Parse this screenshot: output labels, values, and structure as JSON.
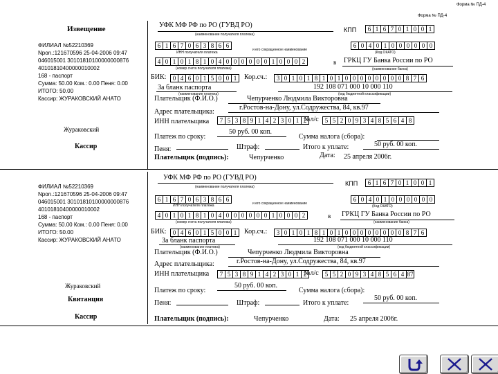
{
  "form_label": "Форма № ПД-4",
  "form_label_inner": "Форма № ПД-4",
  "notice": {
    "title": "Извещение",
    "cashier": "Кассир",
    "signature": "Жураковский",
    "receipt_lines": [
      "ФИЛИАЛ №52210369",
      "Npon.:121670596 25-04-2006 09:47",
      "046015001 30101810100000000876",
      "40101810400000010002",
      "168 - паспорт",
      "Сумма: 50.00 Ком.: 0.00 Пеня: 0.00",
      "ИТОГО:             50.00",
      "Кассир: ЖУРАКОВСКИЙ АНАТО"
    ],
    "payee": "УФК МФ РФ по РО (ГУВД РО)",
    "payee_caption": "(наименование получателя платежа)",
    "kpp_label": "КПП",
    "kpp_digits": [
      "6",
      "1",
      "6",
      "7",
      "0",
      "1",
      "0",
      "0",
      "1"
    ],
    "inn_digits": [
      "6",
      "1",
      "6",
      "7",
      "0",
      "6",
      "3",
      "8",
      "6",
      "6"
    ],
    "inn_caption": "ИНН получателя платежа",
    "code_caption": "и его сокращенное наименование",
    "okato_digits": [
      "6",
      "0",
      "4",
      "0",
      "1",
      "0",
      "0",
      "0",
      "0",
      "0",
      "0"
    ],
    "okato_caption": "(Код ОКАТО)",
    "account_digits": [
      "4",
      "0",
      "1",
      "0",
      "1",
      "8",
      "1",
      "0",
      "4",
      "0",
      "0",
      "0",
      "0",
      "0",
      "0",
      "1",
      "0",
      "0",
      "0",
      "2"
    ],
    "account_caption": "(номер счета получателя платежа)",
    "in_label": "в",
    "bank_name": "ГРКЦ ГУ Банка России по РО",
    "bank_caption": "(наименование банка)",
    "bik_label": "БИК:",
    "bik_digits": [
      "0",
      "4",
      "6",
      "0",
      "1",
      "5",
      "0",
      "0",
      "1"
    ],
    "kor_label": "Кор.сч.:",
    "kor_digits": [
      "3",
      "0",
      "1",
      "0",
      "1",
      "8",
      "1",
      "0",
      "1",
      "0",
      "0",
      "0",
      "0",
      "0",
      "0",
      "0",
      "0",
      "8",
      "7",
      "6"
    ],
    "purpose": "За бланк паспорта",
    "purpose_caption": "(наименование платежа)",
    "kbk": "192 108 071 000 10 000 110",
    "kbk_caption": "(код бюджетной классификации)",
    "payer_label": "Плательщик (Ф.И.О.)",
    "payer_name": "Чепурченко Людмила Викторовна",
    "address_label": "Адрес плательщика:",
    "address": "г.Ростов-на-Дону, ул.Содружества, 84, кв.97",
    "payer_inn_label": "ИНН плательщика",
    "payer_inn_digits": [
      "7",
      "5",
      "3",
      "8",
      "9",
      "1",
      "4",
      "2",
      "3",
      "0",
      "1",
      "2"
    ],
    "ls_label": "№л/с",
    "ls_digits": [
      "5",
      "5",
      "2",
      "0",
      "9",
      "3",
      "4",
      "8",
      "5",
      "6",
      "4",
      "8"
    ],
    "sum_label": "Платеж по сроку:",
    "sum_value": "50 руб. 00 коп.",
    "tax_label": "Сумма налога (сбора):",
    "fine_label": "Пеня:",
    "penalty_label": "Штраф:",
    "total_label": "Итого к уплате:",
    "total_value": "50 руб. 00 коп.",
    "date_label": "Дата:",
    "date_value": "25 апреля 2006г.",
    "sign_label": "Плательщик (подпись):",
    "sign_value": "Чепурченко"
  },
  "receipt": {
    "title": "Квитанция",
    "cashier": "Кассир",
    "signature": "Жураковский",
    "receipt_lines": [
      "ФИЛИАЛ №52210369",
      "Npon.:121670596 25-04-2006 09:47",
      "046015001 30101810100000000876",
      "40101810400000010002",
      "168 - паспорт",
      "Сумма: 50.00 Ком.: 0.00 Пеня: 0.00",
      "ИТОГО:             50.00",
      "Кассир: ЖУРАКОВСКИЙ АНАТО"
    ],
    "payee": "УФК МФ РФ по РО (ГУВД РО)",
    "payee_caption": "(наименование получателя платежа)",
    "kpp_label": "КПП",
    "kpp_digits": [
      "6",
      "1",
      "6",
      "7",
      "0",
      "1",
      "0",
      "0",
      "1"
    ],
    "inn_digits": [
      "6",
      "1",
      "6",
      "7",
      "0",
      "6",
      "3",
      "8",
      "6",
      "6"
    ],
    "inn_caption": "ИНН получателя платежа",
    "code_caption": "и его сокращенное наименование",
    "okato_digits": [
      "6",
      "0",
      "4",
      "0",
      "1",
      "0",
      "0",
      "0",
      "0",
      "0",
      "0"
    ],
    "okato_caption": "(Код ОКАТО)",
    "account_digits": [
      "4",
      "0",
      "1",
      "0",
      "1",
      "8",
      "1",
      "0",
      "4",
      "0",
      "0",
      "0",
      "0",
      "0",
      "0",
      "1",
      "0",
      "0",
      "0",
      "2"
    ],
    "account_caption": "(номер счета получателя платежа)",
    "in_label": "в",
    "bank_name": "ГРКЦ ГУ Банка России по РО",
    "bank_caption": "(наименование банка)",
    "bik_label": "БИК:",
    "bik_digits": [
      "0",
      "4",
      "6",
      "0",
      "1",
      "5",
      "0",
      "0",
      "1"
    ],
    "kor_label": "Кор.сч.:",
    "kor_digits": [
      "3",
      "0",
      "1",
      "0",
      "1",
      "8",
      "1",
      "0",
      "1",
      "0",
      "0",
      "0",
      "0",
      "0",
      "0",
      "0",
      "0",
      "8",
      "7",
      "6"
    ],
    "purpose": "За бланк паспорта",
    "purpose_caption": "(наименование платежа)",
    "kbk": "192 108 071 000 10 000 110",
    "kbk_caption": "(код бюджетной классификации)",
    "payer_label": "Плательщик (Ф.И.О.)",
    "payer_name": "Чепурченко Людмила Викторовна",
    "address_label": "Адрес плательщика:",
    "address": "г.Ростов-на-Дону, ул.Содружества, 84, кв.97",
    "payer_inn_label": "ИНН плательщика",
    "payer_inn_digits": [
      "7",
      "5",
      "3",
      "8",
      "9",
      "1",
      "4",
      "2",
      "3",
      "0",
      "1",
      "2"
    ],
    "ls_label": "№л/с",
    "ls_digits": [
      "5",
      "5",
      "2",
      "0",
      "9",
      "3",
      "4",
      "8",
      "5",
      "6",
      "4",
      "87"
    ],
    "sum_label": "Платеж по сроку:",
    "sum_value": "50 руб. 00 коп.",
    "tax_label": "Сумма налога (сбора):",
    "tax_value": "50 руб. 00 коп.",
    "fine_label": "Пеня:",
    "penalty_label": "Штраф:",
    "total_label": "Итого к уплате:",
    "date_label": "Дата:",
    "date_value": "25 апреля 2006г.",
    "sign_label": "Плательщик (подпись):",
    "sign_value": "Чепурченко"
  },
  "nav": {
    "return_icon": "return-icon",
    "prev_icon": "previous-slide-icon",
    "next_icon": "next-slide-icon"
  }
}
